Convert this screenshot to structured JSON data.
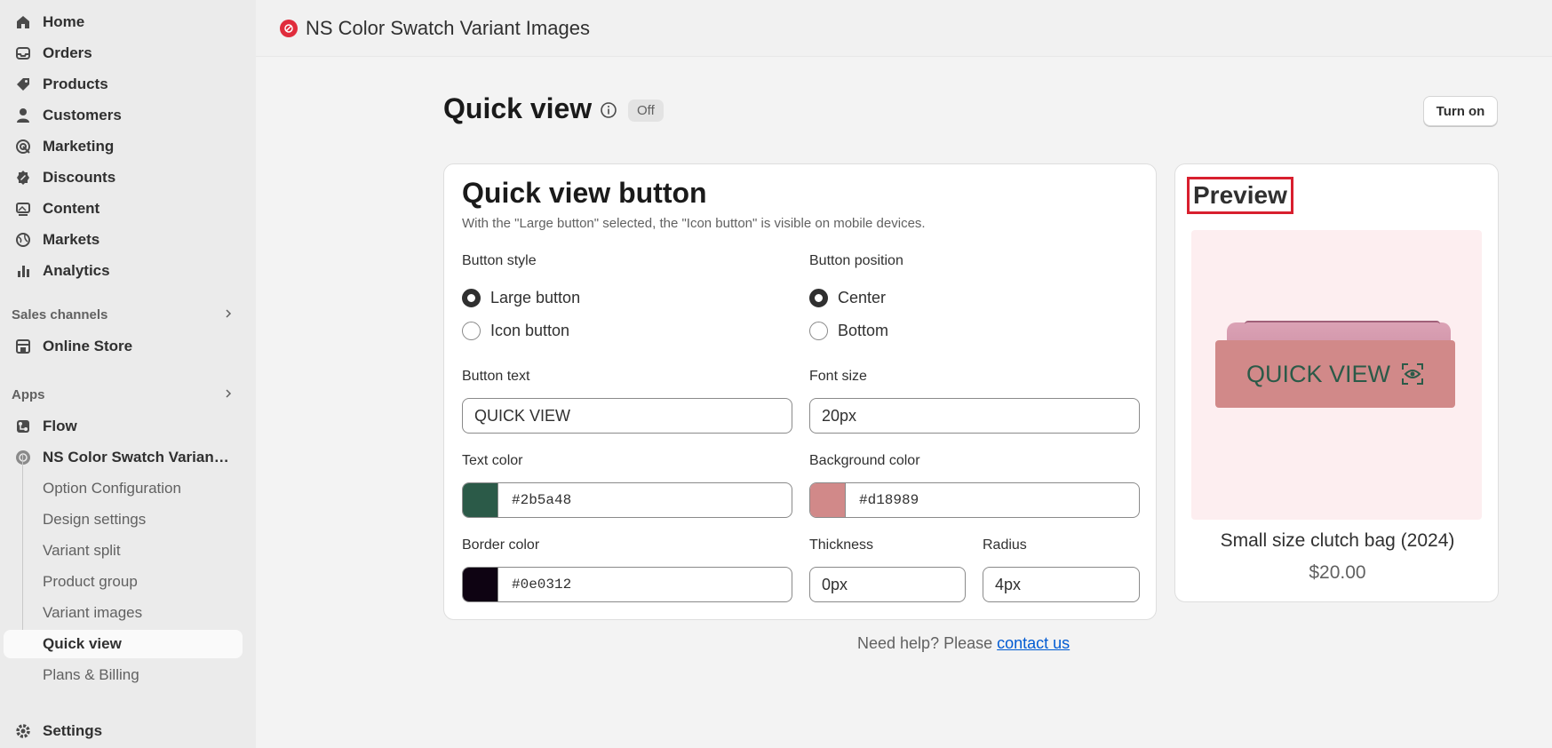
{
  "sidebar": {
    "items": [
      {
        "label": "Home",
        "icon": "home-icon"
      },
      {
        "label": "Orders",
        "icon": "inbox-icon"
      },
      {
        "label": "Products",
        "icon": "tag-icon"
      },
      {
        "label": "Customers",
        "icon": "person-icon"
      },
      {
        "label": "Marketing",
        "icon": "target-icon"
      },
      {
        "label": "Discounts",
        "icon": "discount-icon"
      },
      {
        "label": "Content",
        "icon": "image-icon"
      },
      {
        "label": "Markets",
        "icon": "globe-icon"
      },
      {
        "label": "Analytics",
        "icon": "bar-chart-icon"
      }
    ],
    "sales_channels_label": "Sales channels",
    "online_store_label": "Online Store",
    "apps_label": "Apps",
    "flow_label": "Flow",
    "app_label": "NS Color Swatch Variant Images",
    "app_subitems": [
      "Option Configuration",
      "Design settings",
      "Variant split",
      "Product group",
      "Variant images",
      "Quick view",
      "Plans & Billing"
    ],
    "settings_label": "Settings"
  },
  "topbar": {
    "app_title": "NS Color Swatch Variant Images"
  },
  "page": {
    "title": "Quick view",
    "status_badge": "Off",
    "turn_on_label": "Turn on"
  },
  "card": {
    "title": "Quick view button",
    "description": "With the \"Large button\" selected, the \"Icon button\" is visible on mobile devices.",
    "button_style_label": "Button style",
    "button_style_options": [
      "Large button",
      "Icon button"
    ],
    "button_style_selected": "Large button",
    "button_position_label": "Button position",
    "button_position_options": [
      "Center",
      "Bottom"
    ],
    "button_position_selected": "Center",
    "button_text_label": "Button text",
    "button_text_value": "QUICK VIEW",
    "font_size_label": "Font size",
    "font_size_value": "20px",
    "text_color_label": "Text color",
    "text_color_value": "#2b5a48",
    "bg_color_label": "Background color",
    "bg_color_value": "#d18989",
    "border_color_label": "Border color",
    "border_color_value": "#0e0312",
    "thickness_label": "Thickness",
    "thickness_value": "0px",
    "radius_label": "Radius",
    "radius_value": "4px"
  },
  "preview": {
    "title": "Preview",
    "button_text": "QUICK VIEW",
    "product_name": "Small size clutch bag (2024)",
    "product_price": "$20.00"
  },
  "help": {
    "text": "Need help? Please ",
    "link": "contact us"
  },
  "colors": {
    "accent_red": "#e02c3c",
    "link": "#005bd3"
  }
}
